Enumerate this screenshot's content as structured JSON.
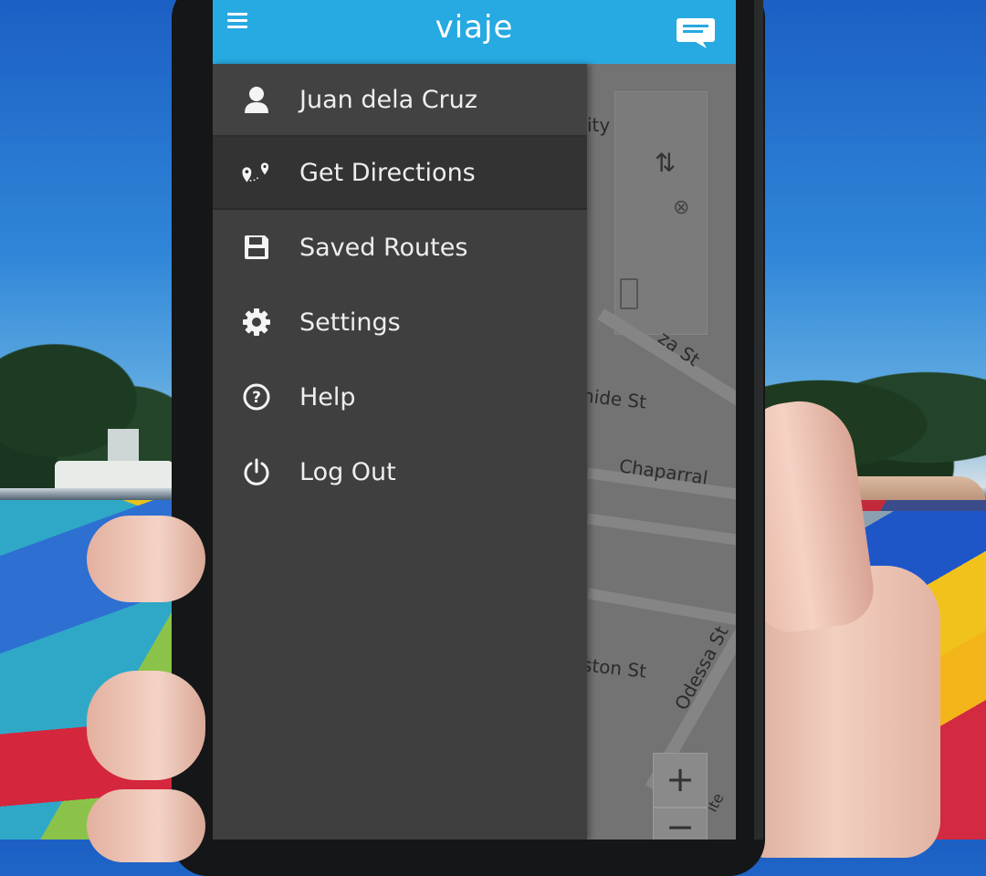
{
  "app": {
    "title": "viaje"
  },
  "drawer": {
    "user_name": "Juan dela Cruz",
    "items": [
      {
        "label": "Get Directions",
        "icon": "directions-pin-icon",
        "active": true
      },
      {
        "label": "Saved Routes",
        "icon": "save-icon",
        "active": false
      },
      {
        "label": "Settings",
        "icon": "gear-icon",
        "active": false
      },
      {
        "label": "Help",
        "icon": "help-icon",
        "active": false
      },
      {
        "label": "Log Out",
        "icon": "power-icon",
        "active": false
      }
    ]
  },
  "map": {
    "labels": {
      "partial_city": "ity",
      "street_1": "za St",
      "street_2": "hide St",
      "street_3": "Chaparral",
      "street_4": "ston St",
      "street_5": "Odessa St",
      "street_6": "ite"
    },
    "swap_symbol": "⇅",
    "clear_symbol": "⊗",
    "zoom_in": "+",
    "zoom_out": "−"
  },
  "colors": {
    "app_bar": "#27a9e1",
    "drawer_bg": "#3f3f3f",
    "drawer_active": "#333333",
    "drawer_text": "#eeeeee"
  }
}
